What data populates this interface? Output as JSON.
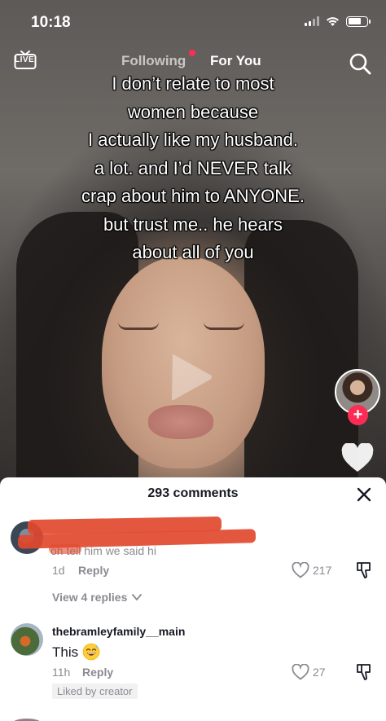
{
  "status_bar": {
    "time": "10:18"
  },
  "header": {
    "live_label": "LIVE",
    "tabs": [
      {
        "label": "Following",
        "active": false,
        "has_dot": true
      },
      {
        "label": "For You",
        "active": true
      }
    ]
  },
  "video": {
    "caption_lines": [
      "I don’t relate to most",
      "women because",
      "I actually like my husband.",
      "a lot. and I’d NEVER talk",
      "crap about him to ANYONE.",
      "but trust me.. he hears",
      "about all of you"
    ]
  },
  "sidebar": {
    "follow_symbol": "+"
  },
  "comments": {
    "title": "293 comments",
    "items": [
      {
        "username": "",
        "partial_text": "oh             tell him we said hi",
        "age": "1d",
        "reply_label": "Reply",
        "likes": "217",
        "view_replies": "View 4 replies"
      },
      {
        "username": "thebramleyfamily__main",
        "text": "This",
        "emoji": "😅",
        "age": "11h",
        "reply_label": "Reply",
        "likes": "27",
        "badge": "Liked by creator"
      }
    ]
  },
  "colors": {
    "accent": "#fe2c55",
    "redaction": "#e2492f",
    "muted_text": "#8a8b91"
  },
  "icons": [
    "live-icon",
    "search-icon",
    "play-icon",
    "heart-icon",
    "close-icon",
    "like-heart-icon",
    "dislike-icon",
    "chevron-down-icon"
  ]
}
